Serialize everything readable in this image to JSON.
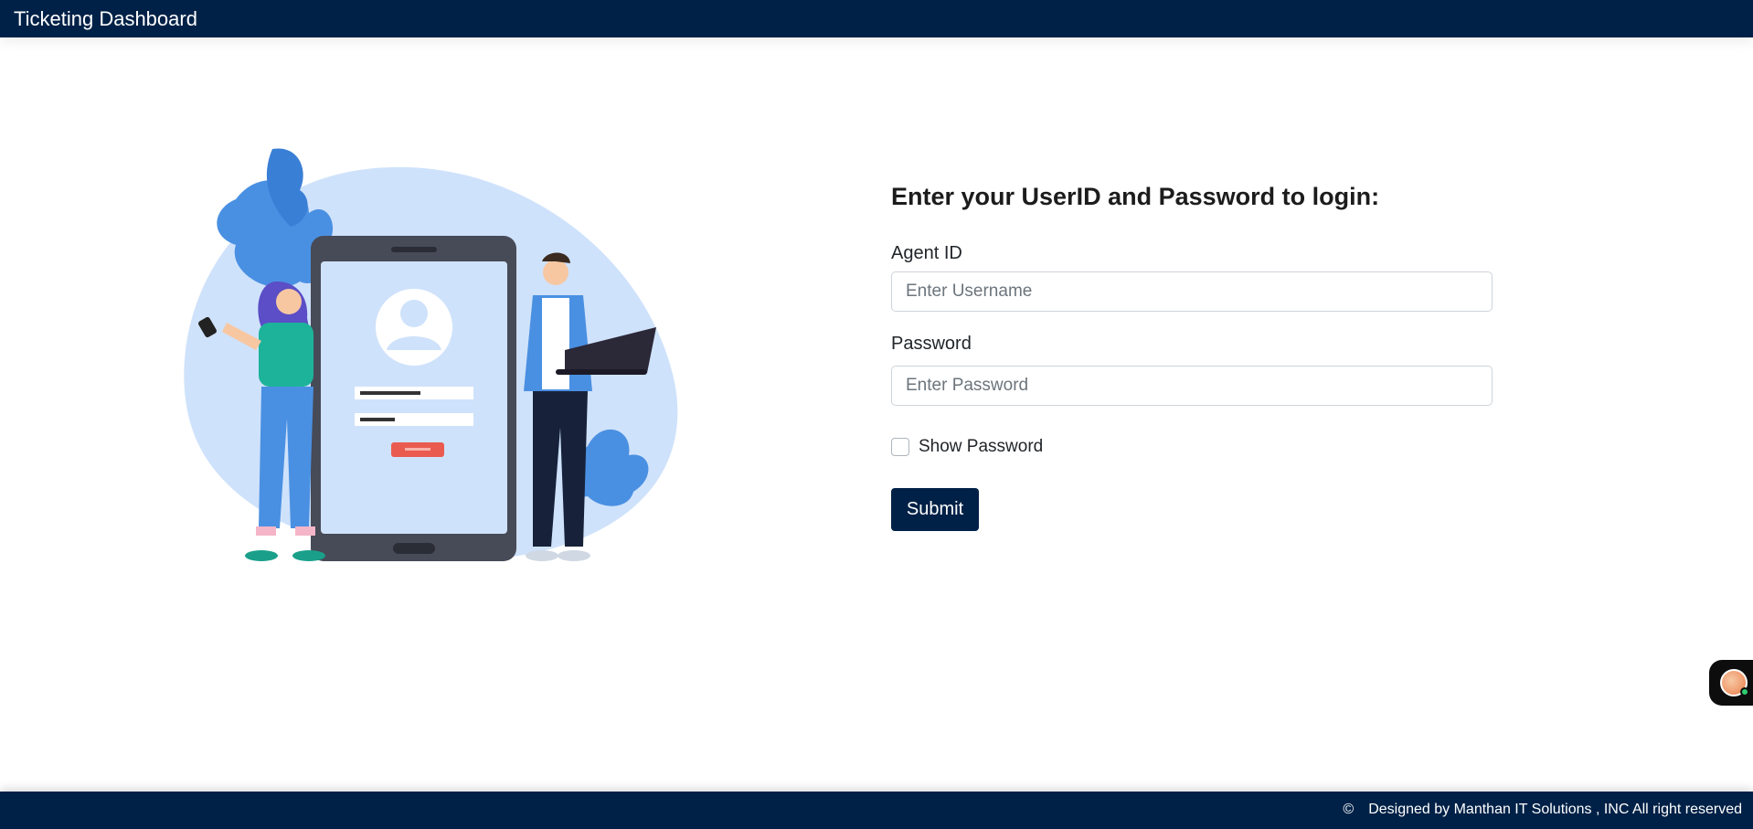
{
  "header": {
    "title": "Ticketing Dashboard"
  },
  "login": {
    "heading": "Enter your UserID and Password to login:",
    "agent_label": "Agent ID",
    "username_placeholder": "Enter Username",
    "password_label": "Password",
    "password_placeholder": "Enter Password",
    "show_password_label": "Show Password",
    "submit_label": "Submit"
  },
  "footer": {
    "copyright_symbol": "©",
    "text": "Designed by Manthan IT Solutions ,  INC All right reserved"
  },
  "colors": {
    "primary": "#002147",
    "illustration_blue": "#cfe2fb",
    "accent_blue": "#4a90e2"
  },
  "icons": {
    "copyright": "copyright-icon",
    "chat": "chat-widget-icon"
  }
}
